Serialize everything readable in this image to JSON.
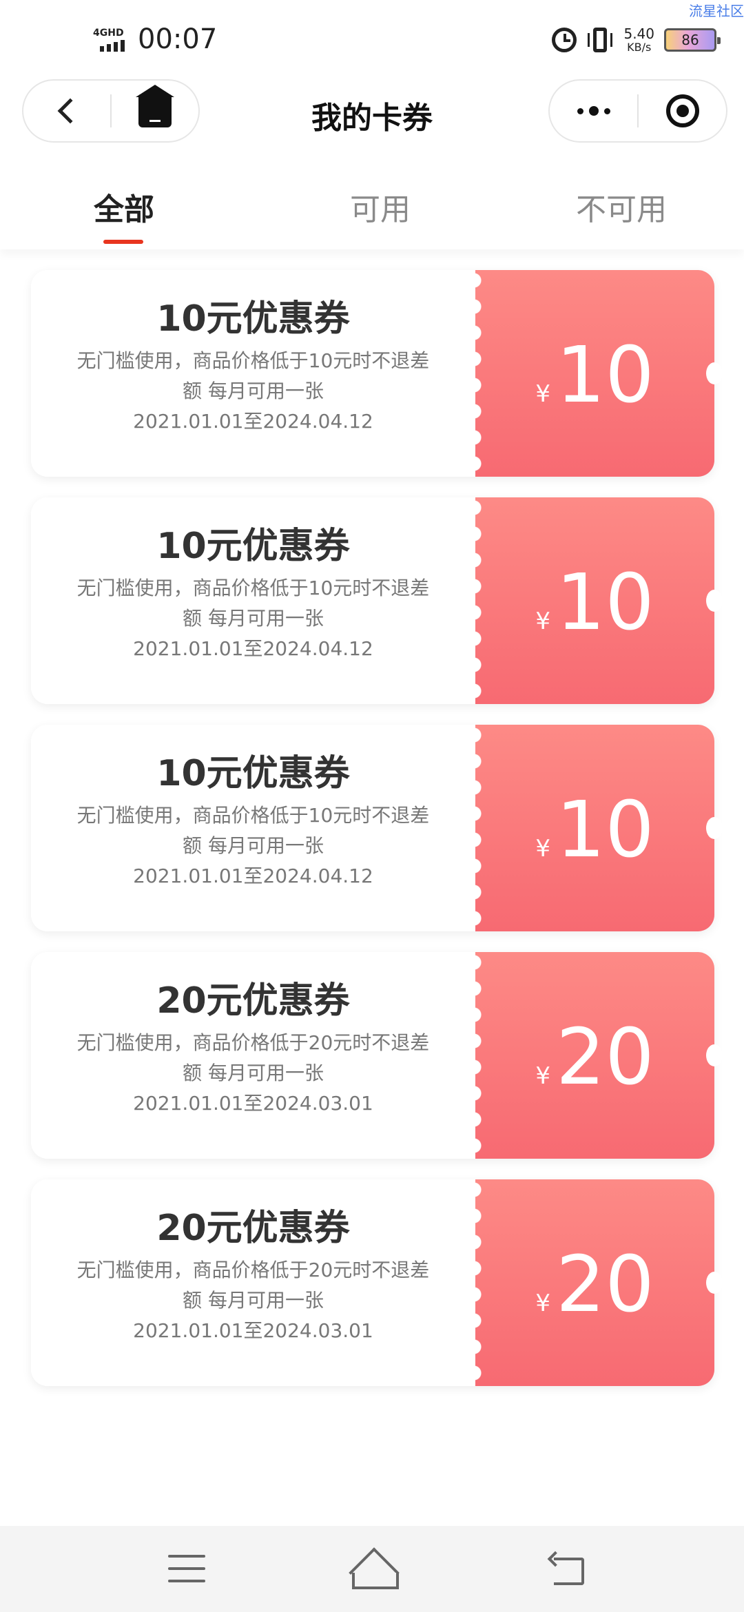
{
  "status_bar": {
    "watermark": "流星社区",
    "network": "4GHD",
    "time": "00:07",
    "speed_value": "5.40",
    "speed_unit": "KB/s",
    "battery": "86",
    "icons": [
      "alarm-icon",
      "vibrate-icon",
      "battery-icon"
    ]
  },
  "navbar": {
    "title": "我的卡券",
    "left_icons": [
      "back-icon",
      "home-icon"
    ],
    "right_icons": [
      "more-icon",
      "target-icon"
    ]
  },
  "tabs": [
    {
      "label": "全部",
      "active": true
    },
    {
      "label": "可用",
      "active": false
    },
    {
      "label": "不可用",
      "active": false
    }
  ],
  "coupons": [
    {
      "title": "10元优惠券",
      "desc": "无门槛使用，商品价格低于10元时不退差额 每月可用一张",
      "date": "2021.01.01至2024.04.12",
      "currency": "¥",
      "amount": "10"
    },
    {
      "title": "10元优惠券",
      "desc": "无门槛使用，商品价格低于10元时不退差额 每月可用一张",
      "date": "2021.01.01至2024.04.12",
      "currency": "¥",
      "amount": "10"
    },
    {
      "title": "10元优惠券",
      "desc": "无门槛使用，商品价格低于10元时不退差额 每月可用一张",
      "date": "2021.01.01至2024.04.12",
      "currency": "¥",
      "amount": "10"
    },
    {
      "title": "20元优惠券",
      "desc": "无门槛使用，商品价格低于20元时不退差额 每月可用一张",
      "date": "2021.01.01至2024.03.01",
      "currency": "¥",
      "amount": "20"
    },
    {
      "title": "20元优惠券",
      "desc": "无门槛使用，商品价格低于20元时不退差额 每月可用一张",
      "date": "2021.01.01至2024.03.01",
      "currency": "¥",
      "amount": "20"
    }
  ],
  "colors": {
    "accent": "#e8351f",
    "coupon_top": "#fd8a86",
    "coupon_bottom": "#f76a72"
  },
  "bottom_nav": [
    "menu-icon",
    "home-outline-icon",
    "back-outline-icon"
  ]
}
